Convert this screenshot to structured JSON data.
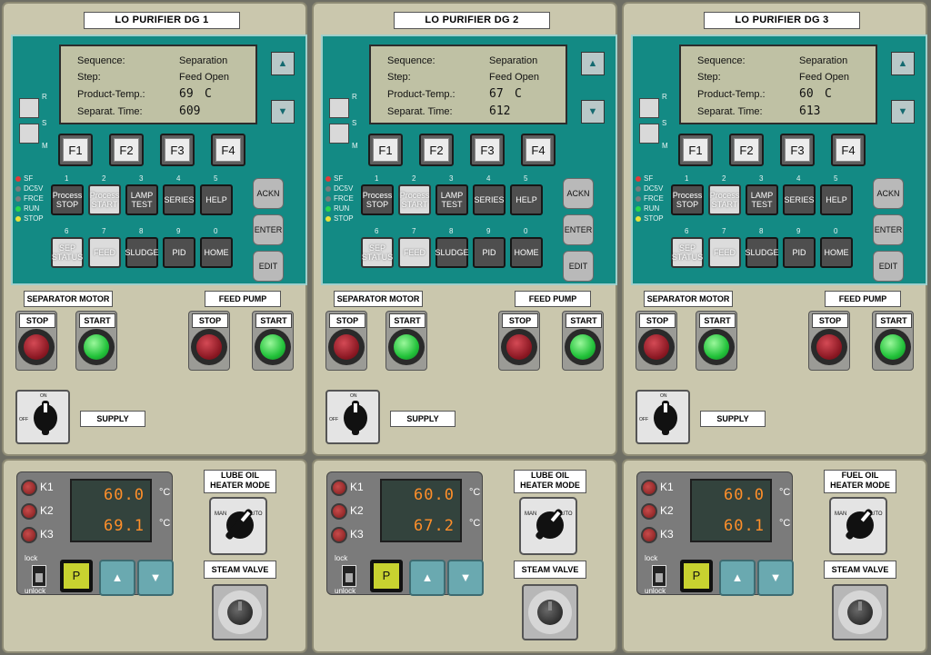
{
  "units": [
    {
      "title": "LO PURIFIER DG 1",
      "lcd": {
        "sequence_label": "Sequence:",
        "sequence": "Separation",
        "step_label": "Step:",
        "step": "Feed Open",
        "temp_label": "Product-Temp.:",
        "temp": "69",
        "temp_unit": "C",
        "time_label": "Separat. Time:",
        "time": "609"
      },
      "heater_mode": "LUBE OIL HEATER MODE",
      "display_upper": "60.0",
      "display_lower": "69.1"
    },
    {
      "title": "LO PURIFIER DG 2",
      "lcd": {
        "sequence_label": "Sequence:",
        "sequence": "Separation",
        "step_label": "Step:",
        "step": "Feed Open",
        "temp_label": "Product-Temp.:",
        "temp": "67",
        "temp_unit": "C",
        "time_label": "Separat. Time:",
        "time": "612"
      },
      "heater_mode": "LUBE OIL HEATER MODE",
      "display_upper": "60.0",
      "display_lower": "67.2"
    },
    {
      "title": "LO PURIFIER DG 3",
      "lcd": {
        "sequence_label": "Sequence:",
        "sequence": "Separation",
        "step_label": "Step:",
        "step": "Feed Open",
        "temp_label": "Product-Temp.:",
        "temp": "60",
        "temp_unit": "C",
        "time_label": "Separat. Time:",
        "time": "613"
      },
      "heater_mode": "FUEL OIL HEATER MODE",
      "display_upper": "60.0",
      "display_lower": "60.1"
    }
  ],
  "common": {
    "rsm": [
      "R",
      "S",
      "M"
    ],
    "f_keys": [
      "F1",
      "F2",
      "F3",
      "F4"
    ],
    "leds": [
      {
        "label": "SF",
        "color": "#e03a3a"
      },
      {
        "label": "DC5V",
        "color": "#7a7a7a"
      },
      {
        "label": "FRCE",
        "color": "#7a7a7a"
      },
      {
        "label": "RUN",
        "color": "#2bd64a"
      },
      {
        "label": "STOP",
        "color": "#e8e33a"
      }
    ],
    "row1_nums": [
      "1",
      "2",
      "3",
      "4",
      "5"
    ],
    "row1": [
      "Process STOP",
      "Process START",
      "LAMP TEST",
      "SERIES",
      "HELP"
    ],
    "row2_nums": [
      "6",
      "7",
      "8",
      "9",
      "0"
    ],
    "row2": [
      "SEP STATUS",
      "FEED",
      "SLUDGE",
      "PID",
      "HOME"
    ],
    "side": [
      "ACKN",
      "ENTER",
      "EDIT"
    ],
    "up_arrow": "▲",
    "down_arrow": "▼",
    "separator_motor": "SEPARATOR MOTOR",
    "feed_pump": "FEED PUMP",
    "stop": "STOP",
    "start": "START",
    "supply": "SUPPLY",
    "switch_on": "ON",
    "switch_off": "OFF",
    "k_labels": [
      "K1",
      "K2",
      "K3"
    ],
    "deg_c": "°C",
    "lock": "lock",
    "unlock": "unlock",
    "p_key": "P",
    "steam_valve": "STEAM  VALVE",
    "man": "MAN",
    "auto": "AUTO"
  }
}
